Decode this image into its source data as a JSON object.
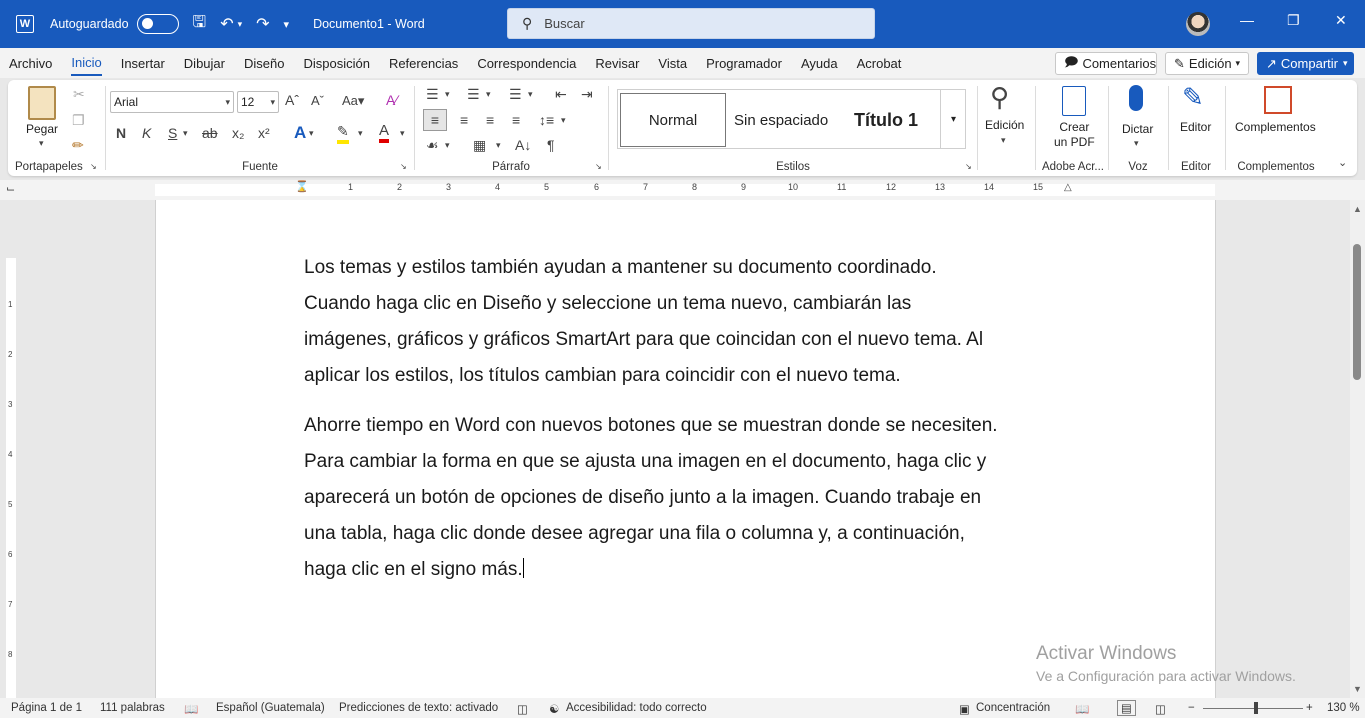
{
  "titlebar": {
    "autosave_label": "Autoguardado",
    "document_title": "Documento1  -  Word",
    "search_placeholder": "Buscar"
  },
  "menu": {
    "tabs": [
      "Archivo",
      "Inicio",
      "Insertar",
      "Dibujar",
      "Diseño",
      "Disposición",
      "Referencias",
      "Correspondencia",
      "Revisar",
      "Vista",
      "Programador",
      "Ayuda",
      "Acrobat"
    ],
    "active_tab": "Inicio",
    "comments_label": "Comentarios",
    "edit_mode_label": "Edición",
    "share_label": "Compartir"
  },
  "ribbon": {
    "clipboard": {
      "paste_label": "Pegar",
      "group_label": "Portapapeles"
    },
    "font": {
      "family": "Arial",
      "size": "12",
      "group_label": "Fuente",
      "bold": "N",
      "italic": "K",
      "underline": "S",
      "strike": "ab",
      "subscript": "x₂",
      "superscript": "x²",
      "case": "Aa"
    },
    "paragraph": {
      "group_label": "Párrafo"
    },
    "styles": {
      "group_label": "Estilos",
      "items": [
        "Normal",
        "Sin espaciado",
        "Título 1"
      ]
    },
    "editing": {
      "label": "Edición"
    },
    "acrobat": {
      "label_line1": "Crear",
      "label_line2": "un PDF",
      "group_label": "Adobe Acr..."
    },
    "voice": {
      "label": "Dictar",
      "group_label": "Voz"
    },
    "editor": {
      "label": "Editor",
      "group_label": "Editor"
    },
    "addins": {
      "label": "Complementos",
      "group_label": "Complementos"
    }
  },
  "document": {
    "paragraph1": [
      "Los temas y estilos también ayudan a mantener su documento coordinado.",
      "Cuando haga clic en Diseño y seleccione un tema nuevo, cambiarán las",
      "imágenes, gráficos y gráficos SmartArt para que coincidan con el nuevo tema. Al",
      "aplicar los estilos, los títulos cambian para coincidir con el nuevo tema."
    ],
    "paragraph2": [
      "Ahorre tiempo en Word con nuevos botones que se muestran donde se necesiten.",
      "Para cambiar la forma en que se ajusta una imagen en el documento, haga clic y",
      "aparecerá un botón de opciones de diseño junto a la imagen. Cuando trabaje en",
      "una tabla, haga clic donde desee agregar una fila o columna y, a continuación,",
      "haga clic en el signo más."
    ]
  },
  "watermark": {
    "title": "Activar Windows",
    "subtitle": "Ve a Configuración para activar Windows."
  },
  "statusbar": {
    "page": "Página 1 de 1",
    "words": "111 palabras",
    "language": "Español (Guatemala)",
    "predictions": "Predicciones de texto: activado",
    "accessibility": "Accesibilidad: todo correcto",
    "focus": "Concentración",
    "zoom": "130 %"
  },
  "ruler": {
    "numbers": [
      "1",
      "2",
      "3",
      "4",
      "5",
      "6",
      "7",
      "8",
      "9",
      "10",
      "11",
      "12",
      "13",
      "14",
      "15"
    ],
    "vertical_numbers": [
      "1",
      "2",
      "3",
      "4",
      "5",
      "6",
      "7",
      "8"
    ]
  },
  "colors": {
    "brand": "#185abd",
    "highlight": "#ffe600",
    "font_color": "#e00000"
  }
}
